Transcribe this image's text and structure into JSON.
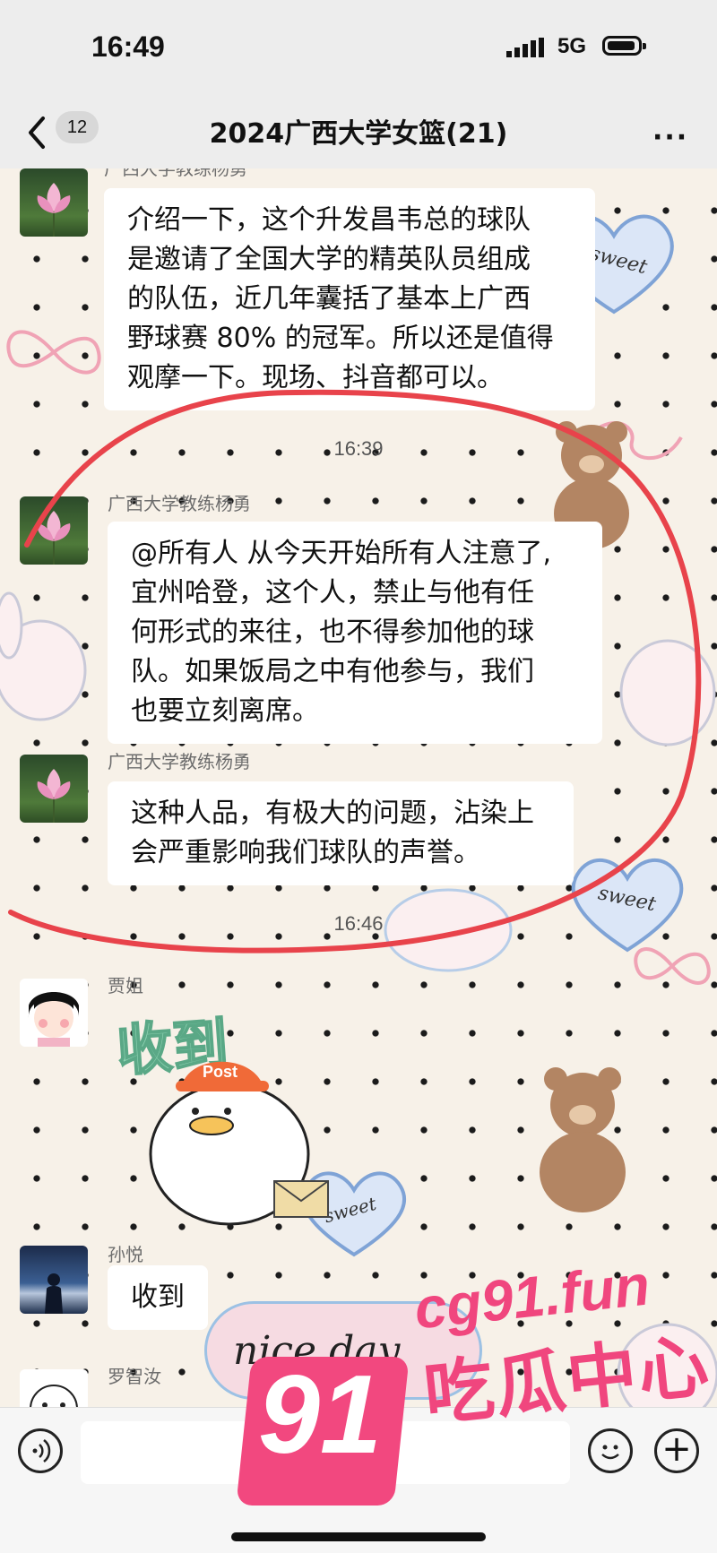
{
  "status_bar": {
    "time": "16:49",
    "network": "5G"
  },
  "nav": {
    "unread_count": "12",
    "title": "2024广西大学女篮(21)",
    "more": "···"
  },
  "chat": {
    "messages": [
      {
        "sender": "广西大学教练杨勇",
        "lines": [
          "介绍一下，这个升发昌韦总的球队",
          "是邀请了全国大学的精英队员组成",
          "的队伍，近几年囊括了基本上广西",
          "野球赛 80% 的冠军。所以还是值得",
          "观摩一下。现场、抖音都可以。"
        ]
      },
      {
        "time": "16:39"
      },
      {
        "sender": "广西大学教练杨勇",
        "lines": [
          "@所有人 从今天开始所有人注意了,",
          "宜州哈登，这个人，禁止与他有任",
          "何形式的来往，也不得参加他的球",
          "队。如果饭局之中有他参与，我们",
          "也要立刻离席。"
        ]
      },
      {
        "sender": "广西大学教练杨勇",
        "lines": [
          "这种人品，有极大的问题，沾染上",
          "会严重影响我们球队的声誉。"
        ]
      },
      {
        "time": "16:46"
      },
      {
        "sender": "贾姐",
        "sticker_text": "收到",
        "sticker_tag": "Post"
      },
      {
        "sender": "孙悦",
        "lines": [
          "收到"
        ]
      },
      {
        "sender": "罗智汝"
      }
    ]
  },
  "stickers": {
    "sweet": "sweet",
    "nice_day": "nice day"
  },
  "watermark": {
    "number": "91",
    "url": "cg91.fun",
    "label": "吃瓜中心"
  },
  "colors": {
    "circle_annotation": "#e8434b",
    "watermark": "#f0467e",
    "dots": "#1b1b1b"
  }
}
